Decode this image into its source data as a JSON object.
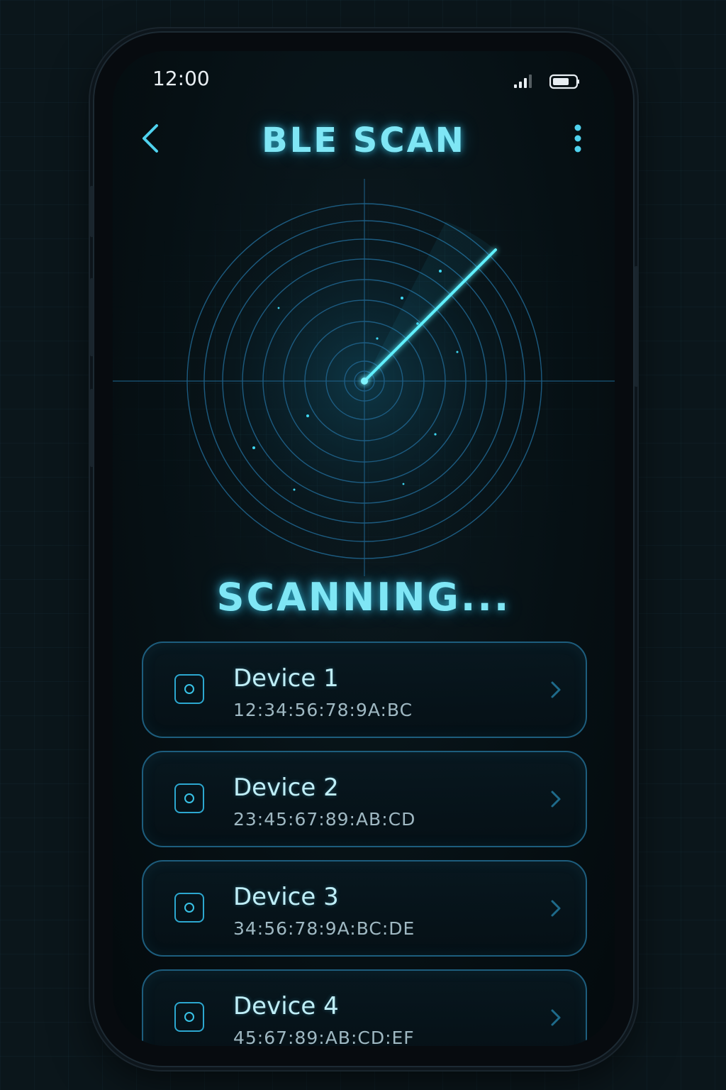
{
  "statusbar": {
    "time": "12:00",
    "signal_icon": "cellular-signal-icon",
    "battery_icon": "battery-icon"
  },
  "header": {
    "title": "BLE SCAN",
    "back_icon": "chevron-left-icon",
    "menu_icon": "more-vertical-icon"
  },
  "radar": {
    "icon": "radar-icon",
    "accent_color": "#3fd8f2"
  },
  "scan_status": "SCANNING...",
  "devices": [
    {
      "name": "Device 1",
      "mac": "12:34:56:78:9A:BC"
    },
    {
      "name": "Device 2",
      "mac": "23:45:67:89:AB:CD"
    },
    {
      "name": "Device 3",
      "mac": "34:56:78:9A:BC:DE"
    },
    {
      "name": "Device 4",
      "mac": "45:67:89:AB:CD:EF"
    }
  ],
  "colors": {
    "accent": "#7fe6f5",
    "border": "#1d5d7d",
    "background": "#061014"
  }
}
